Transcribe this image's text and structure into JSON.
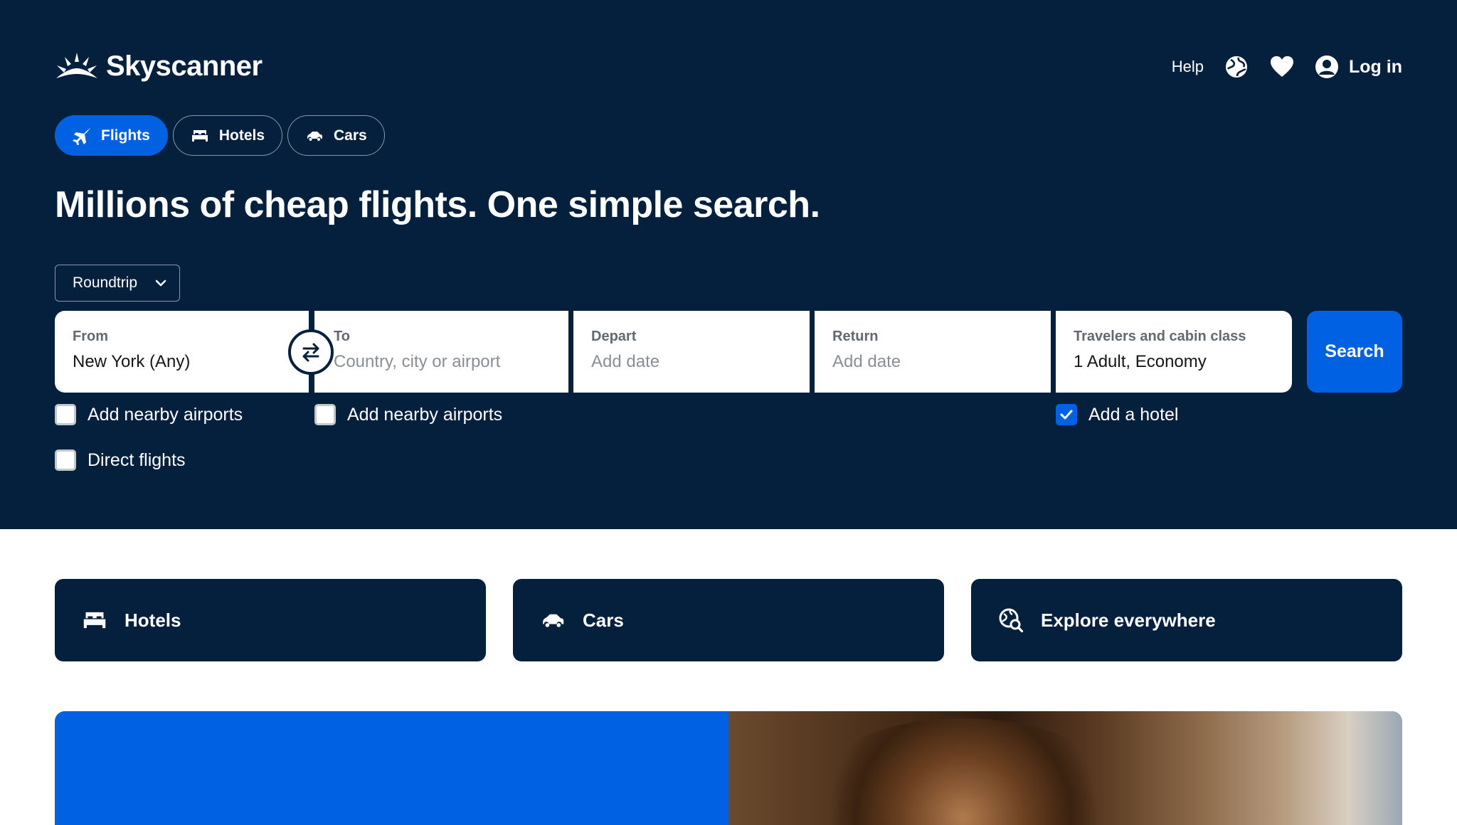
{
  "brand": {
    "name": "Skyscanner"
  },
  "topnav": {
    "help": "Help",
    "login": "Log in"
  },
  "tabs": [
    {
      "label": "Flights",
      "icon": "plane-icon",
      "active": true
    },
    {
      "label": "Hotels",
      "icon": "bed-icon",
      "active": false
    },
    {
      "label": "Cars",
      "icon": "car-icon",
      "active": false
    }
  ],
  "headline": "Millions of cheap flights. One simple search.",
  "trip_type": {
    "selected": "Roundtrip"
  },
  "search": {
    "from": {
      "label": "From",
      "value": "New York (Any)"
    },
    "to": {
      "label": "To",
      "placeholder": "Country, city or airport"
    },
    "depart": {
      "label": "Depart",
      "placeholder": "Add date"
    },
    "return": {
      "label": "Return",
      "placeholder": "Add date"
    },
    "travelers": {
      "label": "Travelers and cabin class",
      "value": "1 Adult, Economy"
    },
    "button": "Search"
  },
  "options": {
    "from_nearby": {
      "label": "Add nearby airports",
      "checked": false
    },
    "to_nearby": {
      "label": "Add nearby airports",
      "checked": false
    },
    "direct": {
      "label": "Direct flights",
      "checked": false
    },
    "hotel": {
      "label": "Add a hotel",
      "checked": true
    }
  },
  "cards": [
    {
      "label": "Hotels",
      "icon": "bed-icon"
    },
    {
      "label": "Cars",
      "icon": "car-icon"
    },
    {
      "label": "Explore everywhere",
      "icon": "globe-search-icon"
    }
  ],
  "colors": {
    "navy": "#05203c",
    "blue": "#0062e3",
    "white": "#ffffff"
  }
}
